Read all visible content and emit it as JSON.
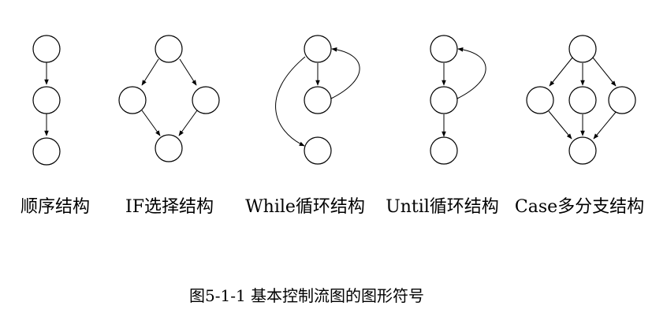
{
  "diagram": {
    "labels": {
      "sequence": "顺序结构",
      "if": "IF选择结构",
      "while": "While循环结构",
      "until": "Until循环结构",
      "case": "Case多分支结构"
    },
    "caption": "图5-1-1  基本控制流图的图形符号"
  }
}
